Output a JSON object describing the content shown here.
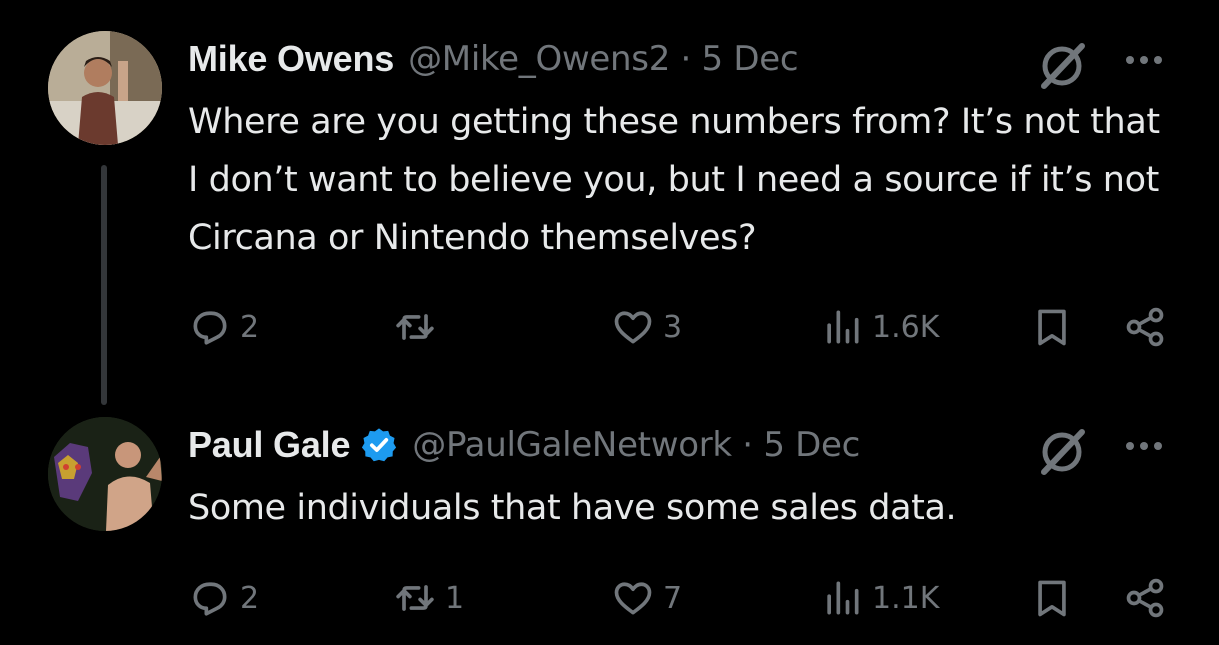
{
  "tweets": [
    {
      "author_name": "Mike Owens",
      "handle_date": "@Mike_Owens2 · 5 Dec",
      "verified": false,
      "text": "Where are you getting these numbers from? It’s not that I don’t want to believe you, but I need a source if it’s not Circana or Nintendo themselves?",
      "replies": "2",
      "reposts": "",
      "likes": "3",
      "views": "1.6K"
    },
    {
      "author_name": "Paul Gale",
      "handle_date": "@PaulGaleNetwork · 5 Dec",
      "verified": true,
      "text": "Some individuals that have some sales data.",
      "replies": "2",
      "reposts": "1",
      "likes": "7",
      "views": "1.1K"
    }
  ],
  "colors": {
    "background": "#000000",
    "text": "#e7e9ea",
    "muted": "#71767b",
    "verified": "#1d9bf0",
    "thread_line": "#333639"
  }
}
